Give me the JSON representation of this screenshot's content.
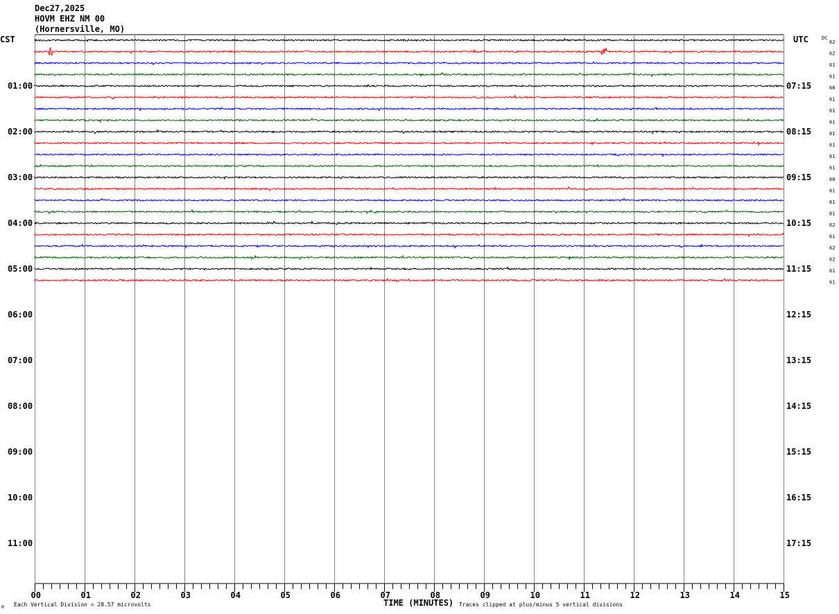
{
  "header": {
    "date": "Dec27,2025",
    "station": "HOVM EHZ NM 00",
    "location": "(Hornersville, MO)"
  },
  "chart_data": {
    "type": "line",
    "title": "Dec27,2025 HOVM EHZ NM 00 (Hornersville, MO)",
    "left_axis_label": "CST",
    "right_axis_label": "UTC",
    "dc_label": "DC",
    "xlabel": "TIME (MINUTES)",
    "x_ticks": [
      "00",
      "01",
      "02",
      "03",
      "04",
      "05",
      "06",
      "07",
      "08",
      "09",
      "10",
      "11",
      "12",
      "13",
      "14",
      "15"
    ],
    "xlim": [
      0,
      15
    ],
    "cst_hour_labels": [
      "01:00",
      "02:00",
      "03:00",
      "04:00",
      "05:00",
      "06:00",
      "07:00",
      "08:00",
      "09:00",
      "10:00",
      "11:00"
    ],
    "utc_hour_labels": [
      "07:15",
      "08:15",
      "09:15",
      "10:15",
      "11:15",
      "12:15",
      "13:15",
      "14:15",
      "15:15",
      "16:15",
      "17:15"
    ],
    "traces_per_hour": 4,
    "total_rows": 48,
    "trace_colors": [
      "#000000",
      "#ff0000",
      "#0000ff",
      "#006400"
    ],
    "dc_offsets": [
      62,
      62,
      61,
      61,
      60,
      61,
      61,
      61,
      61,
      61,
      61,
      61,
      60,
      61,
      61,
      61,
      62,
      61,
      62,
      62,
      61,
      61
    ],
    "grid": true,
    "vertical_division_note": "Each Vertical Division =   28.57 microvolts",
    "clip_note": "Traces clipped at plus/minus 5 vertical divisions",
    "corner_mark": "M"
  }
}
